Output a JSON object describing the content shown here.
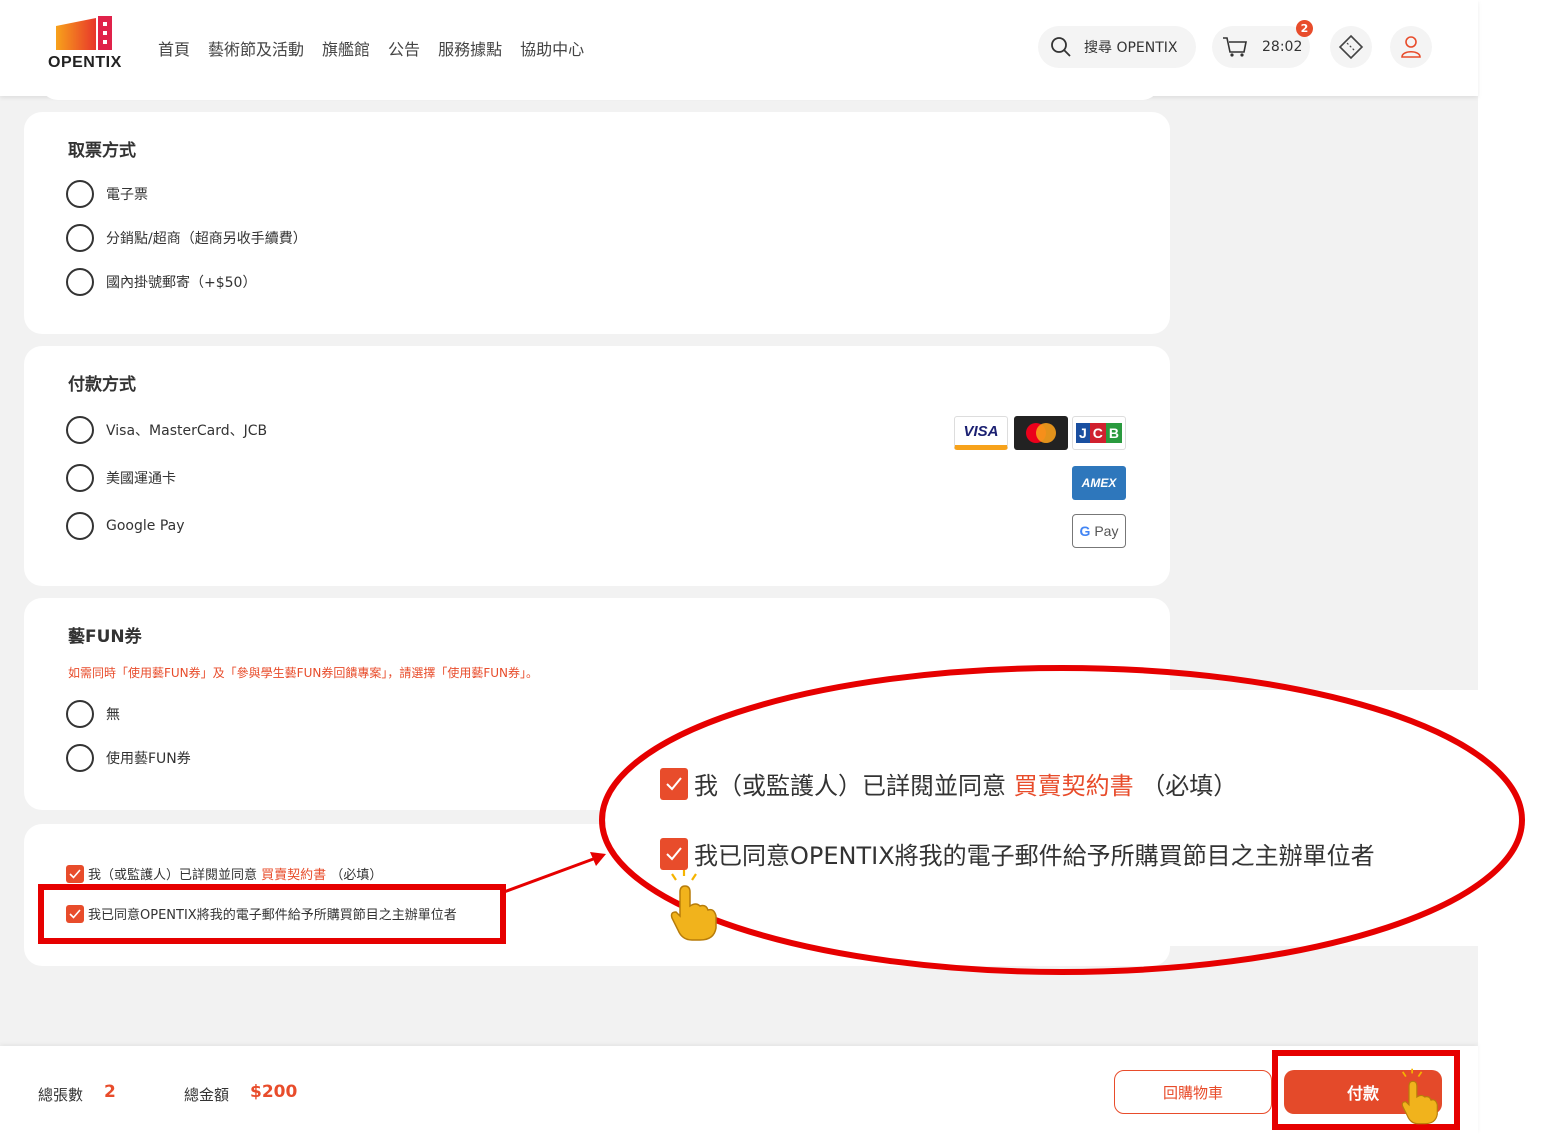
{
  "header": {
    "logo_text": "OPENTIX",
    "nav": [
      "首頁",
      "藝術節及活動",
      "旗艦館",
      "公告",
      "服務據點",
      "協助中心"
    ],
    "search_label": "搜尋 OPENTIX",
    "cart_timer": "28:02",
    "cart_badge": "2"
  },
  "pickup": {
    "title": "取票方式",
    "options": [
      "電子票",
      "分銷點/超商（超商另收手續費）",
      "國內掛號郵寄（+$50）"
    ]
  },
  "payment": {
    "title": "付款方式",
    "options": [
      "Visa、MasterCard、JCB",
      "美國運通卡",
      "Google Pay"
    ],
    "icons": {
      "visa": "VISA",
      "jcb": "JCB",
      "amex": "AMEX",
      "gpay_g": "G",
      "gpay": "Pay"
    }
  },
  "voucher": {
    "title": "藝FUN券",
    "note": "如需同時「使用藝FUN券」及「參與學生藝FUN券回饋專案」，請選擇「使用藝FUN券」。",
    "options": [
      "無",
      "使用藝FUN券"
    ]
  },
  "agreements": {
    "a1_prefix": "我（或監護人）已詳閱並同意",
    "a1_link": "買賣契約書",
    "a1_suffix": "（必填）",
    "a2": "我已同意OPENTIX將我的電子郵件給予所購買節目之主辦單位者"
  },
  "zoom": {
    "a1_prefix": "我（或監護人）已詳閱並同意",
    "a1_link": "買賣契約書",
    "a1_suffix": "（必填）",
    "a2": "我已同意OPENTIX將我的電子郵件給予所購買節目之主辦單位者"
  },
  "footer": {
    "count_label": "總張數",
    "count_value": "2",
    "total_label": "總金額",
    "total_value": "$200",
    "back_button": "回購物車",
    "pay_button": "付款"
  },
  "colors": {
    "accent": "#e84c2b",
    "highlight": "#e60000"
  }
}
